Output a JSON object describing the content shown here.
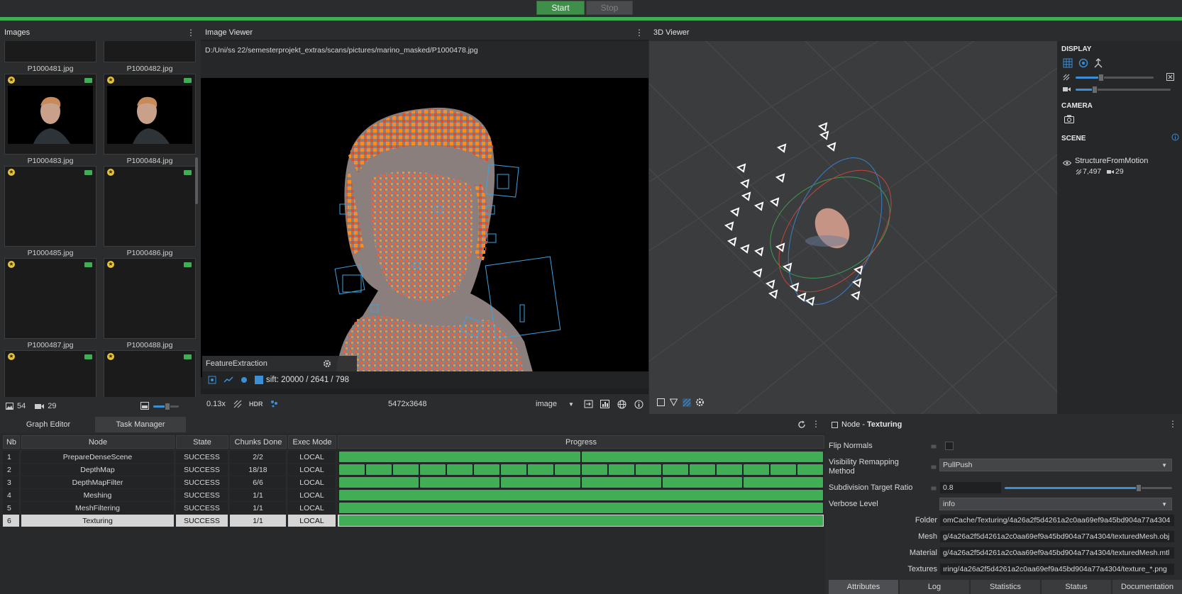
{
  "toolbar": {
    "start_label": "Start",
    "stop_label": "Stop"
  },
  "images_panel": {
    "title": "Images",
    "thumbnails": [
      {
        "name": "P1000481.jpg"
      },
      {
        "name": "P1000482.jpg"
      },
      {
        "name": "P1000483.jpg"
      },
      {
        "name": "P1000484.jpg"
      },
      {
        "name": "P1000485.jpg"
      },
      {
        "name": "P1000486.jpg"
      },
      {
        "name": "P1000487.jpg"
      },
      {
        "name": "P1000488.jpg"
      }
    ],
    "image_count": "54",
    "camera_count": "29",
    "thumb_size_level": 0.55
  },
  "image_viewer": {
    "title": "Image Viewer",
    "path": "D:/Uni/ss 22/semesterprojekt_extras/scans/pictures/marino_masked/P1000478.jpg",
    "feature_node": "FeatureExtraction",
    "sift_text": "sift: 20000 / 2641 / 798",
    "zoom": "0.13x",
    "hdr_label": "HDR",
    "resolution": "5472x3648",
    "image_mode": "image"
  },
  "viewer3d": {
    "title": "3D Viewer",
    "display_label": "DISPLAY",
    "camera_label": "CAMERA",
    "scene_label": "SCENE",
    "scene_item": "StructureFromMotion",
    "point_count": "7,497",
    "camera_count": "29",
    "point_size_level": 0.33,
    "camera_scale_level": 0.2
  },
  "bottom_tabs": {
    "graph_editor": "Graph Editor",
    "task_manager": "Task Manager"
  },
  "task_table": {
    "headers": [
      "Nb",
      "Node",
      "State",
      "Chunks Done",
      "Exec Mode",
      "Progress"
    ],
    "rows": [
      {
        "nb": "1",
        "node": "PrepareDenseScene",
        "state": "SUCCESS",
        "chunks": "2/2",
        "mode": "LOCAL",
        "segments": 2
      },
      {
        "nb": "2",
        "node": "DepthMap",
        "state": "SUCCESS",
        "chunks": "18/18",
        "mode": "LOCAL",
        "segments": 18
      },
      {
        "nb": "3",
        "node": "DepthMapFilter",
        "state": "SUCCESS",
        "chunks": "6/6",
        "mode": "LOCAL",
        "segments": 6
      },
      {
        "nb": "4",
        "node": "Meshing",
        "state": "SUCCESS",
        "chunks": "1/1",
        "mode": "LOCAL",
        "segments": 1
      },
      {
        "nb": "5",
        "node": "MeshFiltering",
        "state": "SUCCESS",
        "chunks": "1/1",
        "mode": "LOCAL",
        "segments": 1
      },
      {
        "nb": "6",
        "node": "Texturing",
        "state": "SUCCESS",
        "chunks": "1/1",
        "mode": "LOCAL",
        "segments": 1
      }
    ]
  },
  "node_panel": {
    "title_prefix": "Node - ",
    "title_name": "Texturing",
    "flip_normals_label": "Flip Normals",
    "visibility_label_1": "Visibility Remapping",
    "visibility_label_2": "Method",
    "visibility_value": "PullPush",
    "subdivision_label": "Subdivision Target Ratio",
    "subdivision_value": "0.8",
    "subdivision_level": 0.8,
    "verbose_label": "Verbose Level",
    "verbose_value": "info",
    "folder_label": "Folder",
    "folder_value": "omCache/Texturing/4a26a2f5d4261a2c0aa69ef9a45bd904a77a4304",
    "mesh_label": "Mesh",
    "mesh_value": "g/4a26a2f5d4261a2c0aa69ef9a45bd904a77a4304/texturedMesh.obj",
    "material_label": "Material",
    "material_value": "g/4a26a2f5d4261a2c0aa69ef9a45bd904a77a4304/texturedMesh.mtl",
    "textures_label": "Textures",
    "textures_value": "ıring/4a26a2f5d4261a2c0aa69ef9a45bd904a77a4304/texture_*.png",
    "tabs": [
      "Attributes",
      "Log",
      "Statistics",
      "Status",
      "Documentation"
    ]
  },
  "colors": {
    "accent_green": "#3fae54",
    "accent_blue": "#3a8fd6",
    "selected_row": "#d5d5d5"
  }
}
